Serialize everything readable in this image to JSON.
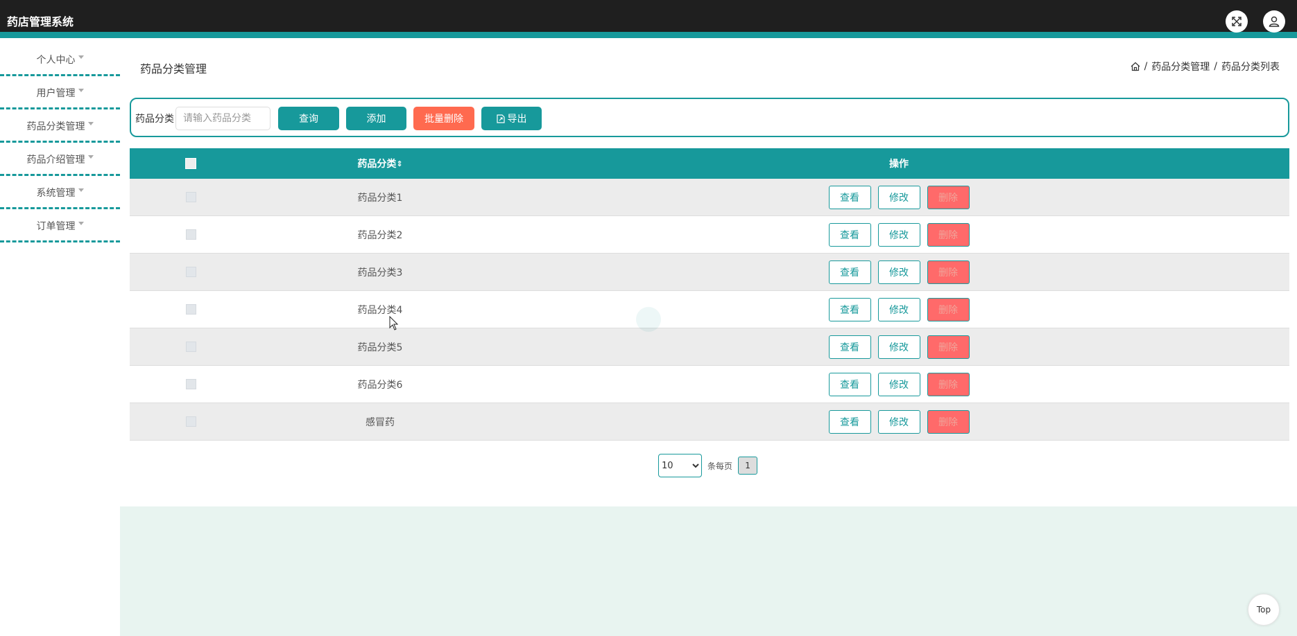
{
  "app": {
    "title": "药店管理系统"
  },
  "header_icons": [
    "fullscreen-icon",
    "user-icon"
  ],
  "sidebar": {
    "items": [
      {
        "label": "个人中心"
      },
      {
        "label": "用户管理"
      },
      {
        "label": "药品分类管理"
      },
      {
        "label": "药品介绍管理"
      },
      {
        "label": "系统管理"
      },
      {
        "label": "订单管理"
      }
    ]
  },
  "page": {
    "title": "药品分类管理",
    "breadcrumb": {
      "sep1": "/",
      "level1": "药品分类管理",
      "sep2": "/",
      "level2": "药品分类列表"
    }
  },
  "search": {
    "label": "药品分类",
    "placeholder": "请输入药品分类",
    "value": "",
    "query_label": "查询",
    "add_label": "添加",
    "batch_delete_label": "批量删除",
    "export_label": "导出"
  },
  "table": {
    "headers": {
      "name": "药品分类",
      "sort_icon": "⇕",
      "ops": "操作"
    },
    "rows": [
      {
        "name": "药品分类1"
      },
      {
        "name": "药品分类2"
      },
      {
        "name": "药品分类3"
      },
      {
        "name": "药品分类4"
      },
      {
        "name": "药品分类5"
      },
      {
        "name": "药品分类6"
      },
      {
        "name": "感冒药"
      }
    ],
    "op_labels": {
      "view": "查看",
      "edit": "修改",
      "delete": "删除"
    }
  },
  "pagination": {
    "page_size": "10",
    "page_size_options": [
      "10"
    ],
    "per_page_label": "条每页",
    "current_page": "1"
  },
  "back_to_top": {
    "label": "Top"
  },
  "colors": {
    "accent": "#17999b",
    "danger": "#ff6a4f",
    "header_bg": "#1f1f1f"
  }
}
